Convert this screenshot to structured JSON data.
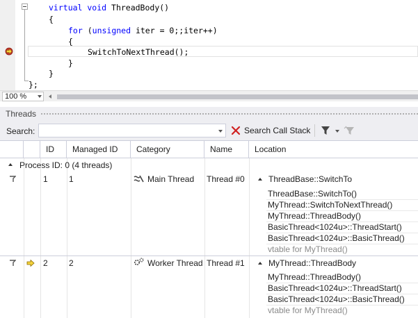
{
  "editor": {
    "lines": [
      {
        "indent": "",
        "kw": "virtual void",
        "rest": " ThreadBody()"
      },
      {
        "indent": "",
        "kw": "",
        "rest": "{"
      },
      {
        "indent": "    ",
        "kw": "for",
        "rest": " (",
        "kw2": "unsigned",
        "rest2": " iter = 0;;iter++)"
      },
      {
        "indent": "    ",
        "kw": "",
        "rest": "{"
      },
      {
        "indent": "        ",
        "kw": "",
        "rest": "SwitchToNextThread();"
      },
      {
        "indent": "    ",
        "kw": "",
        "rest": "}"
      },
      {
        "indent": "",
        "kw": "",
        "rest": "}"
      },
      {
        "indent": "",
        "kw": "",
        "rest": "};"
      }
    ]
  },
  "zoom": {
    "value": "100 %"
  },
  "threads_window": {
    "title": "Threads",
    "search_label": "Search:",
    "search_value": "",
    "search_call_stack_label": "Search Call Stack",
    "columns": {
      "id": "ID",
      "managed_id": "Managed ID",
      "category": "Category",
      "name": "Name",
      "location": "Location"
    },
    "group": {
      "label": "Process ID: 0",
      "count": "(4 threads)"
    },
    "threads": [
      {
        "id": "1",
        "managed_id": "1",
        "category": "Main Thread",
        "category_icon": "main-thread-icon",
        "name": "Thread #0",
        "location": "ThreadBase::SwitchTo",
        "current": false,
        "frames": [
          {
            "text": "ThreadBase::SwitchTo()",
            "external": false
          },
          {
            "text": "MyThread::SwitchToNextThread()",
            "external": false
          },
          {
            "text": "MyThread::ThreadBody()",
            "external": false
          },
          {
            "text": "BasicThread<1024u>::ThreadStart()",
            "external": false
          },
          {
            "text": "BasicThread<1024u>::BasicThread()",
            "external": false
          },
          {
            "text": "vtable for MyThread()",
            "external": true
          }
        ]
      },
      {
        "id": "2",
        "managed_id": "2",
        "category": "Worker Thread",
        "category_icon": "worker-thread-icon",
        "name": "Thread #1",
        "location": "MyThread::ThreadBody",
        "current": true,
        "frames": [
          {
            "text": "MyThread::ThreadBody()",
            "external": false
          },
          {
            "text": "BasicThread<1024u>::ThreadStart()",
            "external": false
          },
          {
            "text": "BasicThread<1024u>::BasicThread()",
            "external": false
          },
          {
            "text": "vtable for MyThread()",
            "external": true
          }
        ]
      }
    ]
  }
}
